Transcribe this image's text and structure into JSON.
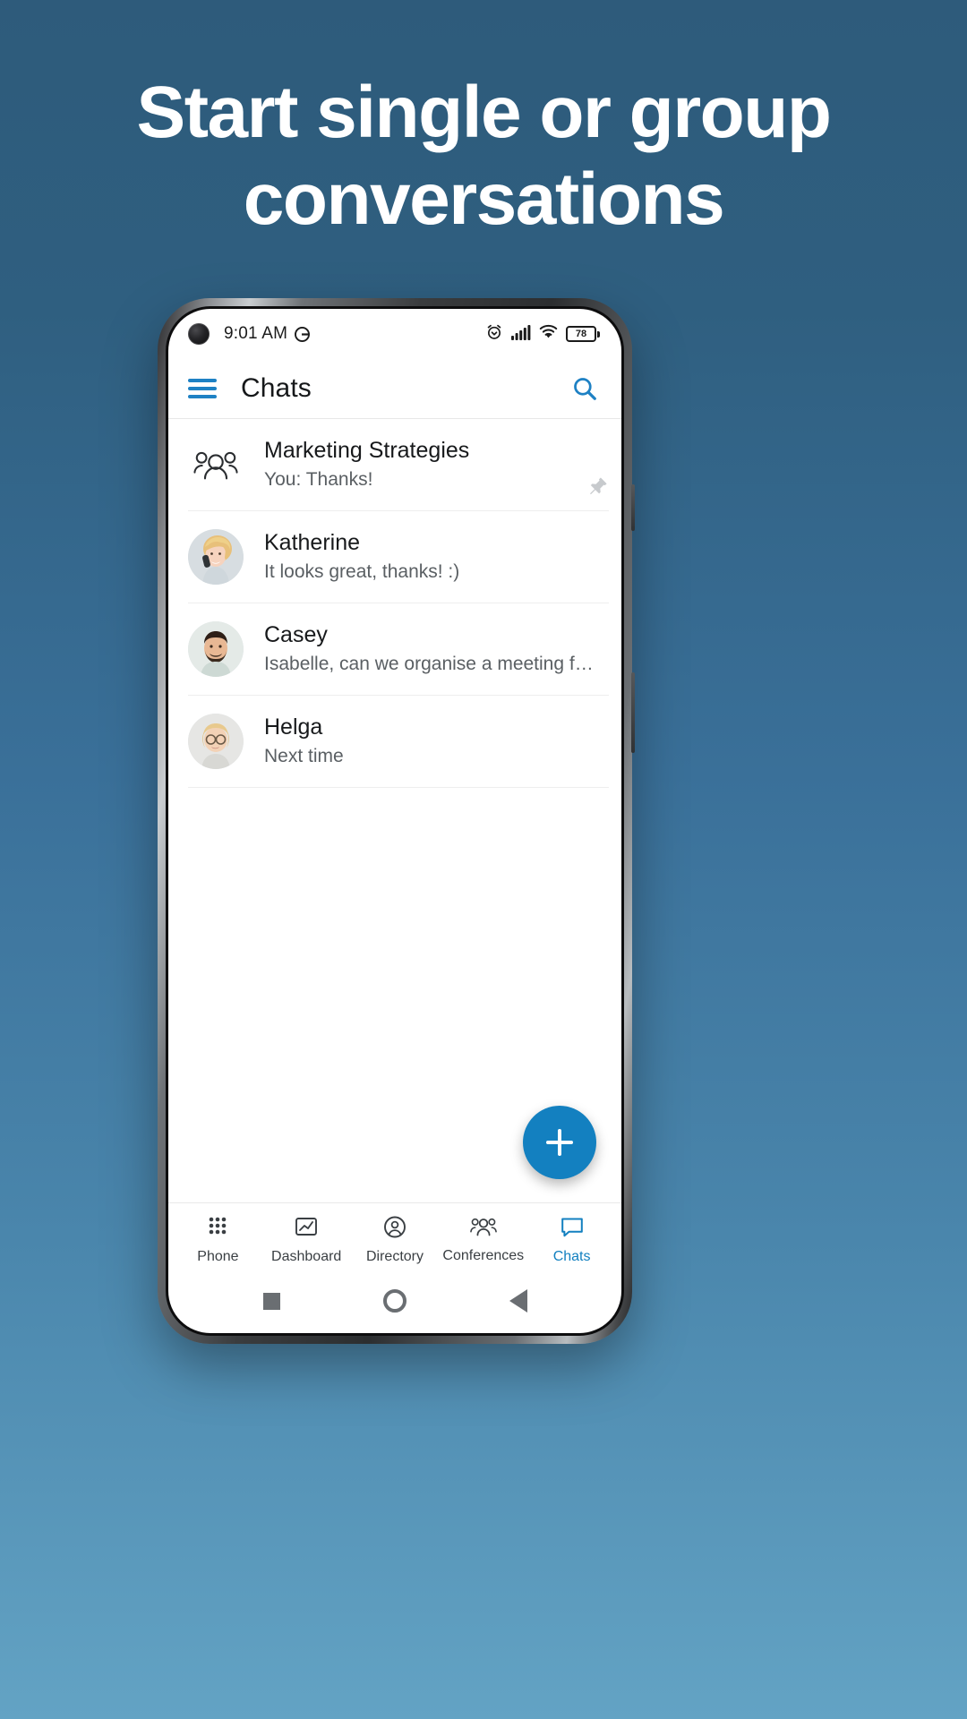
{
  "promo": {
    "headline_line1": "Start single or group",
    "headline_line2": "conversations",
    "bg_top_color": "#2e5b7b",
    "bg_bottom_color": "#63a3c4",
    "text_color": "#ffffff"
  },
  "status_bar": {
    "time": "9:01 AM",
    "dnd_icon": "do-not-disturb-icon",
    "alarm_icon": "alarm-clock-icon",
    "signal_icon": "cellular-signal-icon",
    "wifi_icon": "wifi-icon",
    "battery_level": "78",
    "battery_icon": "battery-icon"
  },
  "app_bar": {
    "menu_icon": "hamburger-menu-icon",
    "title": "Chats",
    "search_icon": "search-icon",
    "accent_color": "#1e81c4"
  },
  "chats": [
    {
      "name": "Marketing Strategies",
      "preview": "You: Thanks!",
      "avatar_type": "group-icon",
      "pinned": true,
      "pin_icon": "pin-icon"
    },
    {
      "name": "Katherine",
      "preview": "It looks great, thanks! :)",
      "avatar_type": "photo",
      "pinned": false
    },
    {
      "name": "Casey",
      "preview": "Isabelle, can we organise a meeting for the …",
      "avatar_type": "photo",
      "pinned": false
    },
    {
      "name": "Helga",
      "preview": "Next time",
      "avatar_type": "photo",
      "pinned": false
    }
  ],
  "fab": {
    "label": "+",
    "icon": "plus-icon",
    "color": "#1380c0"
  },
  "bottom_nav": {
    "active_color": "#1380c0",
    "inactive_color": "#3a3f43",
    "items": [
      {
        "label": "Phone",
        "icon": "dialpad-icon",
        "active": false
      },
      {
        "label": "Dashboard",
        "icon": "chart-icon",
        "active": false
      },
      {
        "label": "Directory",
        "icon": "contact-icon",
        "active": false
      },
      {
        "label": "Conferences",
        "icon": "group-icon",
        "active": false
      },
      {
        "label": "Chats",
        "icon": "chat-bubble-icon",
        "active": true
      }
    ]
  },
  "system_nav": {
    "recents_icon": "square-icon",
    "home_icon": "circle-icon",
    "back_icon": "triangle-back-icon"
  }
}
